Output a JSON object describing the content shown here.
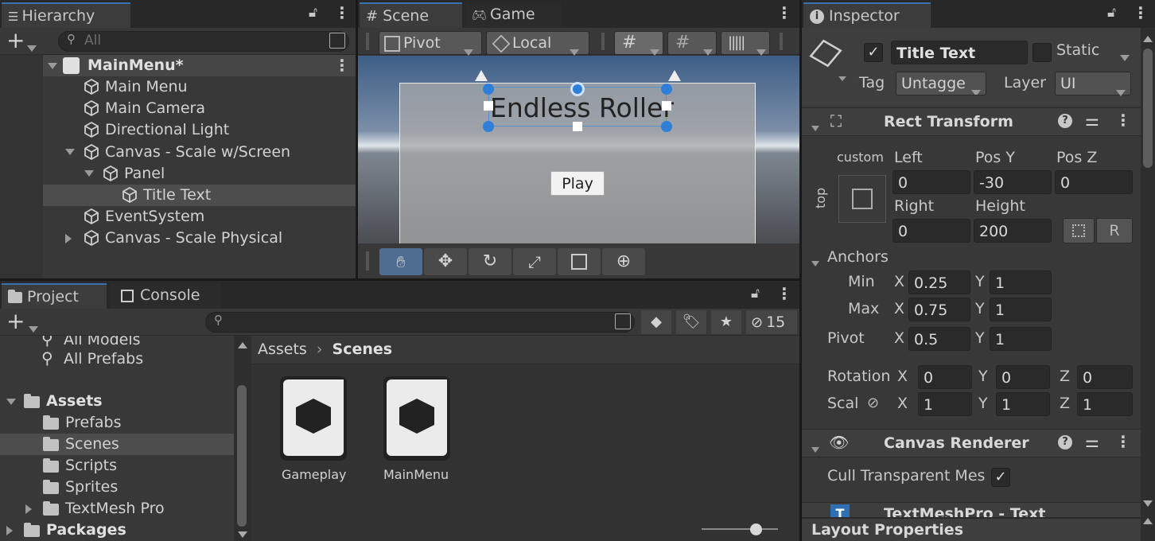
{
  "hierarchy": {
    "tab_label": "Hierarchy",
    "search_placeholder": "All",
    "scene_name": "MainMenu*",
    "items": [
      {
        "label": "Main Menu"
      },
      {
        "label": "Main Camera"
      },
      {
        "label": "Directional Light"
      },
      {
        "label": "Canvas - Scale w/Screen"
      },
      {
        "label": "Panel"
      },
      {
        "label": "Title Text"
      },
      {
        "label": "EventSystem"
      },
      {
        "label": "Canvas - Scale Physical"
      }
    ]
  },
  "scene_view": {
    "tabs": [
      "Scene",
      "Game"
    ],
    "pivot_label": "Pivot",
    "local_label": "Local",
    "title_text": "Endless Roller",
    "play_label": "Play"
  },
  "project": {
    "tabs": [
      "Project",
      "Console"
    ],
    "hidden_count": "15",
    "tree": [
      {
        "label": "All Models"
      },
      {
        "label": "All Prefabs"
      },
      {
        "label": "Assets"
      },
      {
        "label": "Prefabs"
      },
      {
        "label": "Scenes"
      },
      {
        "label": "Scripts"
      },
      {
        "label": "Sprites"
      },
      {
        "label": "TextMesh Pro"
      },
      {
        "label": "Packages"
      }
    ],
    "breadcrumb": [
      "Assets",
      "Scenes"
    ],
    "assets": [
      {
        "label": "Gameplay"
      },
      {
        "label": "MainMenu"
      }
    ],
    "zoom_level": 0.75
  },
  "inspector": {
    "tab_label": "Inspector",
    "object_name": "Title Text",
    "active_checked": true,
    "static_label": "Static",
    "tag_label": "Tag",
    "tag_value": "Untagge",
    "layer_label": "Layer",
    "layer_value": "UI",
    "rect_transform": {
      "title": "Rect Transform",
      "anchor_preset_top": "custom",
      "anchor_preset_side": "top",
      "left_label": "Left",
      "left": "0",
      "posy_label": "Pos Y",
      "pos_y": "-30",
      "posz_label": "Pos Z",
      "pos_z": "0",
      "right_label": "Right",
      "right": "0",
      "height_label": "Height",
      "height": "200",
      "r_button": "R",
      "anchors_label": "Anchors",
      "min_label": "Min",
      "min_x": "0.25",
      "min_y": "1",
      "max_label": "Max",
      "max_x": "0.75",
      "max_y": "1",
      "pivot_label": "Pivot",
      "pivot_x": "0.5",
      "pivot_y": "1",
      "rotation_label": "Rotation",
      "rot_x": "0",
      "rot_y": "0",
      "rot_z": "0",
      "scale_label": "Scal",
      "scale_x": "1",
      "scale_y": "1",
      "scale_z": "1",
      "x": "X",
      "y": "Y",
      "z": "Z"
    },
    "canvas_renderer": {
      "title": "Canvas Renderer",
      "cull_label": "Cull Transparent Mes",
      "cull_checked": true
    },
    "textmeshpro": {
      "title": "TextMeshPro - Text"
    },
    "layout_properties": "Layout Properties"
  },
  "colors": {
    "accent": "#3a72b0",
    "handle_blue": "#2f7fd9"
  }
}
